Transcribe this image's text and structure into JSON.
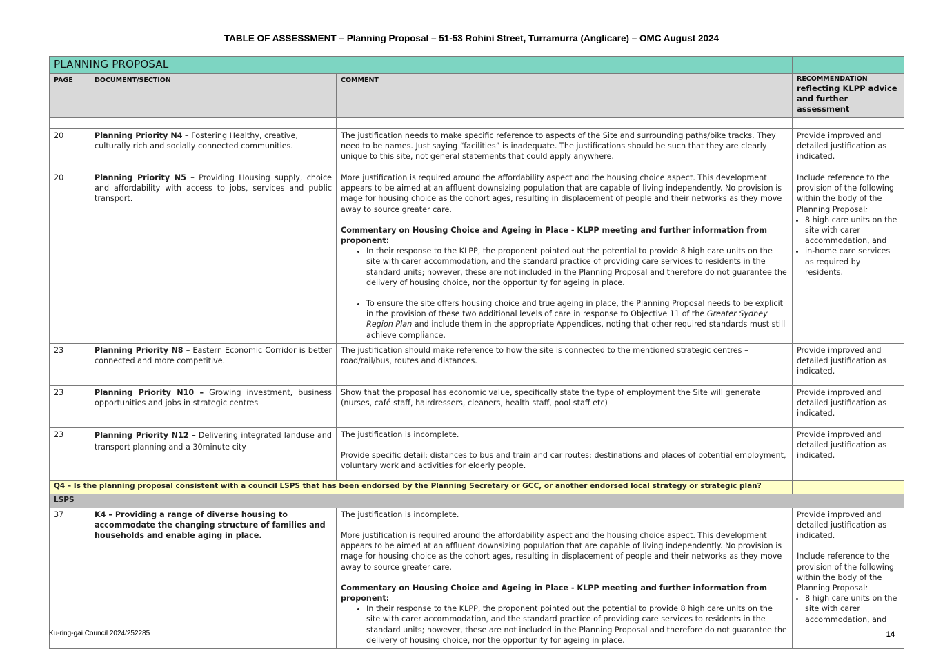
{
  "document": {
    "title": "TABLE OF ASSESSMENT – Planning Proposal – 51-53 Rohini Street, Turramurra (Anglicare) – OMC August 2024",
    "footer_left": "Ku-ring-gai Council 2024/252285",
    "page_number": "14"
  },
  "table": {
    "section_title": "PLANNING PROPOSAL",
    "headers": {
      "page": "PAGE",
      "document_section": "DOCUMENT/SECTION",
      "comment": "COMMENT",
      "recommendation_line1": "RECOMMENDATION",
      "recommendation_line2": "reflecting KLPP advice",
      "recommendation_line3": "and further assessment"
    },
    "rows": [
      {
        "page": "20",
        "section_bold": "Planning Priority N4",
        "section_rest": " – Fostering Healthy, creative, culturally rich and socially connected communities.",
        "comment": "The justification needs to make specific reference to aspects of the Site and surrounding paths/bike tracks. They need to be names. Just saying “facilities” is inadequate. The justifications should be such that they are clearly unique to this site, not general statements that could apply anywhere.",
        "recommendation": "Provide improved and detailed justification as indicated."
      },
      {
        "page": "20",
        "section_bold": "Planning Priority N5",
        "section_rest": " – Providing Housing supply, choice and affordability with access to jobs, services and public transport.",
        "comment_p1": "More justification is required around the affordability aspect and the housing choice aspect. This development appears to be aimed at an affluent downsizing population that are capable of living independently. No provision is mage for housing choice as the cohort ages, resulting in displacement of people and their networks as they move away to source greater care.",
        "commentary_heading": "Commentary on Housing Choice and Ageing in Place - KLPP meeting and further information from proponent:",
        "bullet1": "In their response to the KLPP, the proponent pointed out the potential to provide 8 high care units on the site with carer accommodation, and the standard practice of providing care services to residents in the standard units; however, these are not included in the Planning Proposal and therefore do not guarantee the delivery of housing choice, nor the opportunity for ageing in place.",
        "bullet2_start": "To ensure the site offers housing choice and true ageing in place, the Planning Proposal needs to be explicit in the provision of these two additional levels of care in response to Objective 11 of the ",
        "bullet2_italic": "Greater Sydney Region Plan",
        "bullet2_end": " and include them in the appropriate Appendices, noting that other required standards must still achieve compliance.",
        "rec_intro": "Include reference to the provision of the following within the body of the Planning Proposal",
        "rec_colon": ":",
        "rec_bullet1": "8 high care units on the site with carer accommodation, and",
        "rec_bullet2": "in-home care services as required by residents."
      },
      {
        "page": "23",
        "section_bold": "Planning Priority N8",
        "section_rest": " – Eastern Economic Corridor is better connected and more competitive.",
        "comment": "The justification should make reference to how the site is connected to the mentioned strategic centres – road/rail/bus, routes and distances.",
        "recommendation": "Provide improved and detailed justification as indicated."
      },
      {
        "page": "23",
        "section_bold": "Planning Priority N10 –",
        "section_rest": " Growing investment, business opportunities and jobs in strategic centres",
        "comment": "Show that the proposal has economic value, specifically state the type of employment the Site will generate (nurses, café staff, hairdressers, cleaners, health staff, pool staff etc)",
        "recommendation": "Provide improved and detailed justification as indicated."
      },
      {
        "page": "23",
        "section_bold": "Planning Priority N12 –",
        "section_rest": " Delivering integrated landuse and transport planning  and a 30minute city",
        "comment_p1": "The justification is incomplete.",
        "comment_p2": "Provide specific detail: distances to bus and train and car routes; destinations and places of potential employment, voluntary work and activities for elderly people.",
        "recommendation": "Provide improved and detailed justification as indicated."
      }
    ],
    "question_row": "Q4 – Is the planning proposal consistent with a council LSPS that has been endorsed by the Planning Secretary or GCC, or another endorsed local strategy or strategic plan?",
    "lsps_label": "LSPS",
    "lsps_row": {
      "page": "37",
      "section": "K4 – Providing a range of diverse housing to accommodate the changing structure of families and households and enable aging in place.",
      "comment_p1": "The justification is incomplete.",
      "comment_p2": "More justification is required around the affordability aspect and the housing choice aspect. This development appears to be aimed at an affluent downsizing population that are capable of living independently. No provision is mage for housing choice as the cohort ages, resulting in displacement of people and their networks as they move away to source greater care.",
      "commentary_heading": "Commentary on Housing Choice and Ageing in Place - KLPP meeting and further information from proponent:",
      "bullet1": "In their response to the KLPP, the proponent pointed out the potential to provide 8 high care units on the site with carer accommodation, and the standard practice of providing care services to residents in the standard units; however, these are not included in the Planning Proposal and therefore do not guarantee the delivery of housing choice, nor the opportunity for ageing in place.",
      "rec_p1": "Provide improved and detailed justification as indicated.",
      "rec_intro": "Include reference to the provision of the following within the body of the Planning Proposal",
      "rec_colon": ":",
      "rec_bullet1": "8 high care units on the site with carer accommodation, and"
    }
  }
}
